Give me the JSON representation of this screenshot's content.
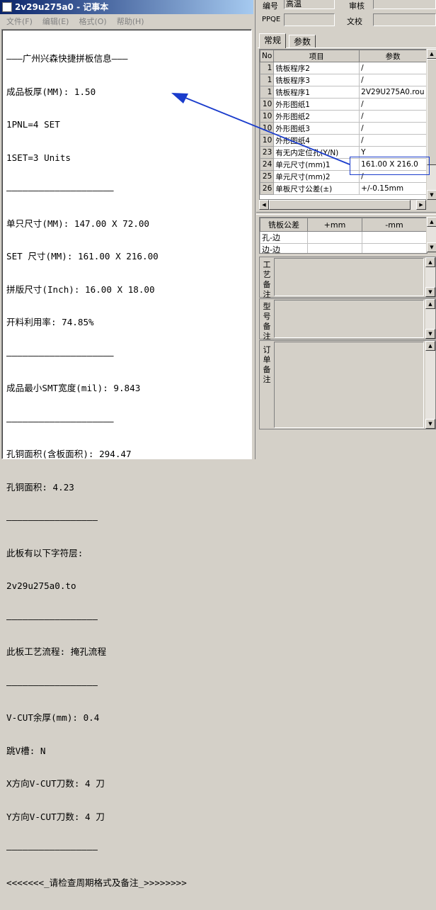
{
  "notepad": {
    "title": "2v29u275a0 - 记事本",
    "menu": [
      "文件(F)",
      "编辑(E)",
      "格式(O)",
      "帮助(H)"
    ],
    "lines": [
      "———广州兴森快捷拼板信息———",
      "成品板厚(MM): 1.50",
      "1PNL=4 SET",
      "1SET=3 Units",
      "————————————————————",
      "单只尺寸(MM): 147.00 X 72.00",
      "SET 尺寸(MM): 161.00 X 216.00",
      "拼版尺寸(Inch): 16.00 X 18.00",
      "开料利用率: 74.85%",
      "————————————————————",
      "成品最小SMT宽度(mil): 9.843",
      "————————————————————",
      "孔铜面积(含板面积): 294.47",
      "孔铜面积: 4.23",
      "—————————————————",
      "此板有以下字符层:",
      "2v29u275a0.to",
      "—————————————————",
      "此板工艺流程: 掩孔流程",
      "—————————————————",
      "V-CUT余厚(mm): 0.4",
      "跳V槽: N",
      "X方向V-CUT刀数: 4 刀",
      "Y方向V-CUT刀数: 4 刀",
      "—————————————————",
      "<<<<<<<_请检查周期格式及备注_>>>>>>>>"
    ]
  },
  "right": {
    "top_fields": {
      "bianhao_label": "编号",
      "bianhao_value": "高温",
      "shenhe_label": "审核",
      "ppqe_label": "PPQE",
      "wenjiao_label": "文校"
    },
    "tabs": [
      "常规",
      "参数"
    ],
    "grid": {
      "headers": [
        "No",
        "项目",
        "参数"
      ],
      "rows": [
        [
          "1",
          "铣板程序2",
          "/"
        ],
        [
          "1",
          "铣板程序3",
          "/"
        ],
        [
          "1",
          "铣板程序1",
          "2V29U275A0.rou"
        ],
        [
          "10",
          "外形图纸1",
          "/"
        ],
        [
          "10",
          "外形图纸2",
          "/"
        ],
        [
          "10",
          "外形图纸3",
          "/"
        ],
        [
          "10",
          "外形图纸4",
          "/"
        ],
        [
          "23",
          "有无内定位孔(Y/N)",
          "Y"
        ],
        [
          "24",
          "单元尺寸(mm)1",
          "161.00 X 216.0"
        ],
        [
          "25",
          "单元尺寸(mm)2",
          "/"
        ],
        [
          "26",
          "单板尺寸公差(±)",
          "+/-0.15mm"
        ]
      ]
    },
    "tolerance": {
      "headers": [
        "铣板公差",
        "+mm",
        "-mm"
      ],
      "rows": [
        "孔-边",
        "边-边"
      ]
    },
    "notes": [
      "工艺备注",
      "型号备注",
      "订单备注"
    ]
  },
  "annotation": {
    "color": "#1a3ccc"
  }
}
